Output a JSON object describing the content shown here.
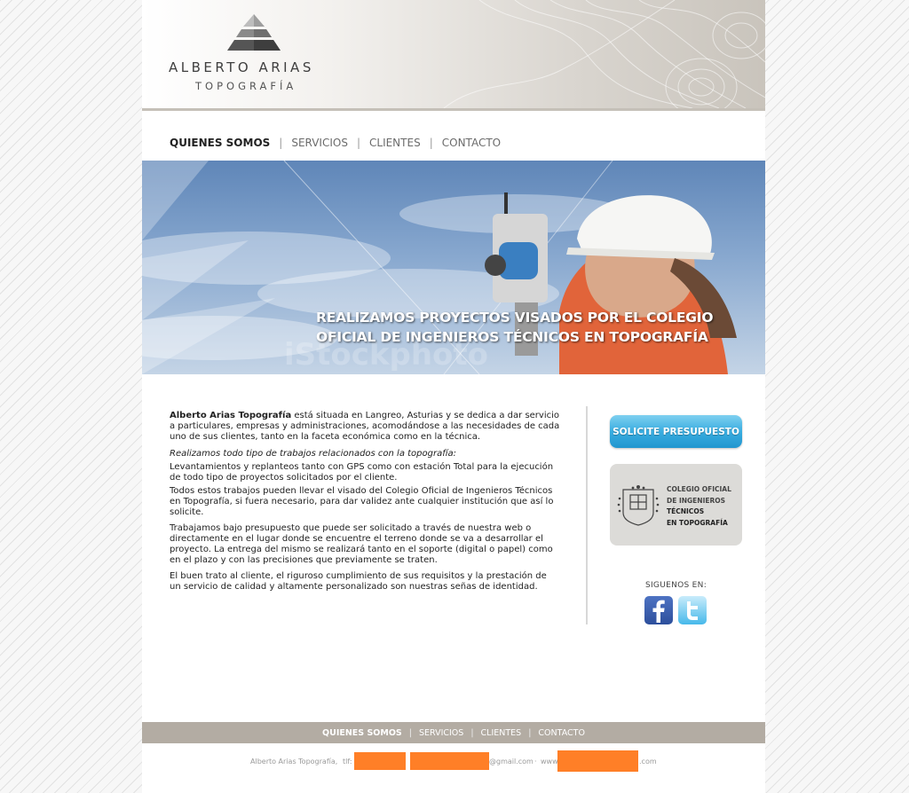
{
  "logo": {
    "name": "ALBERTO ARIAS",
    "subtitle": "TOPOGRAFÍA"
  },
  "nav": {
    "items": [
      {
        "label": "QUIENES SOMOS",
        "active": true
      },
      {
        "label": "SERVICIOS"
      },
      {
        "label": "CLIENTES"
      },
      {
        "label": "CONTACTO"
      }
    ],
    "separator": "|"
  },
  "hero": {
    "line1": "REALIZAMOS PROYECTOS VISADOS POR EL COLEGIO",
    "line2": "OFICIAL DE INGENIEROS TÉCNICOS EN TOPOGRAFÍA",
    "watermark": "iStockphoto"
  },
  "content": {
    "intro_bold": "Alberto Arias Topografía",
    "intro_rest": " está situada en Langreo, Asturias y se dedica a dar servicio a particulares, empresas y administraciones, acomodándose a las necesidades de cada uno de sus clientes, tanto en la faceta económica como en la técnica.",
    "italic_heading": "Realizamos todo tipo de trabajos relacionados con la topografía:",
    "para1": "Levantamientos y replanteos tanto con GPS como con estación Total para la ejecución de todo tipo de proyectos solicitados por el cliente.",
    "para2": "Todos estos trabajos pueden llevar el visado del Colegio Oficial de Ingenieros Técnicos en Topografía, si fuera necesario, para dar validez ante cualquier institución que así lo solicite.",
    "para3": "Trabajamos bajo presupuesto que puede ser solicitado a través de nuestra web o directamente en el lugar donde se encuentre el terreno donde se va a desarrollar el proyecto. La entrega del mismo se realizará tanto en el soporte (digital o papel) como en el plazo y con las precisiones que previamente se traten.",
    "para4": "El buen trato al cliente, el riguroso cumplimiento de sus requisitos y la prestación de un servicio de calidad y altamente personalizado son nuestras señas de identidad."
  },
  "sidebar": {
    "cta": "SOLICITE PRESUPUESTO",
    "college": {
      "line1": "COLEGIO OFICIAL",
      "line2": "DE INGENIEROS",
      "line3": "TÉCNICOS",
      "line4": "EN TOPOGRAFÍA"
    },
    "follow": "SIGUENOS EN:",
    "social": [
      {
        "icon": "facebook-icon"
      },
      {
        "icon": "twitter-icon"
      }
    ]
  },
  "footer": {
    "nav": [
      {
        "label": "QUIENES SOMOS",
        "active": true
      },
      {
        "label": "SERVICIOS"
      },
      {
        "label": "CLIENTES"
      },
      {
        "label": "CONTACTO"
      }
    ],
    "company": "Alberto Arias Topografía,",
    "tlf_label": "tlf:",
    "email_suffix": "@gmail.com",
    "web_sep": "·",
    "web_prefix": "www.",
    "web_suffix": ".com"
  },
  "colors": {
    "accent": "#39ade0",
    "footer": "#b3aca3",
    "redaction": "#ff7f27"
  }
}
